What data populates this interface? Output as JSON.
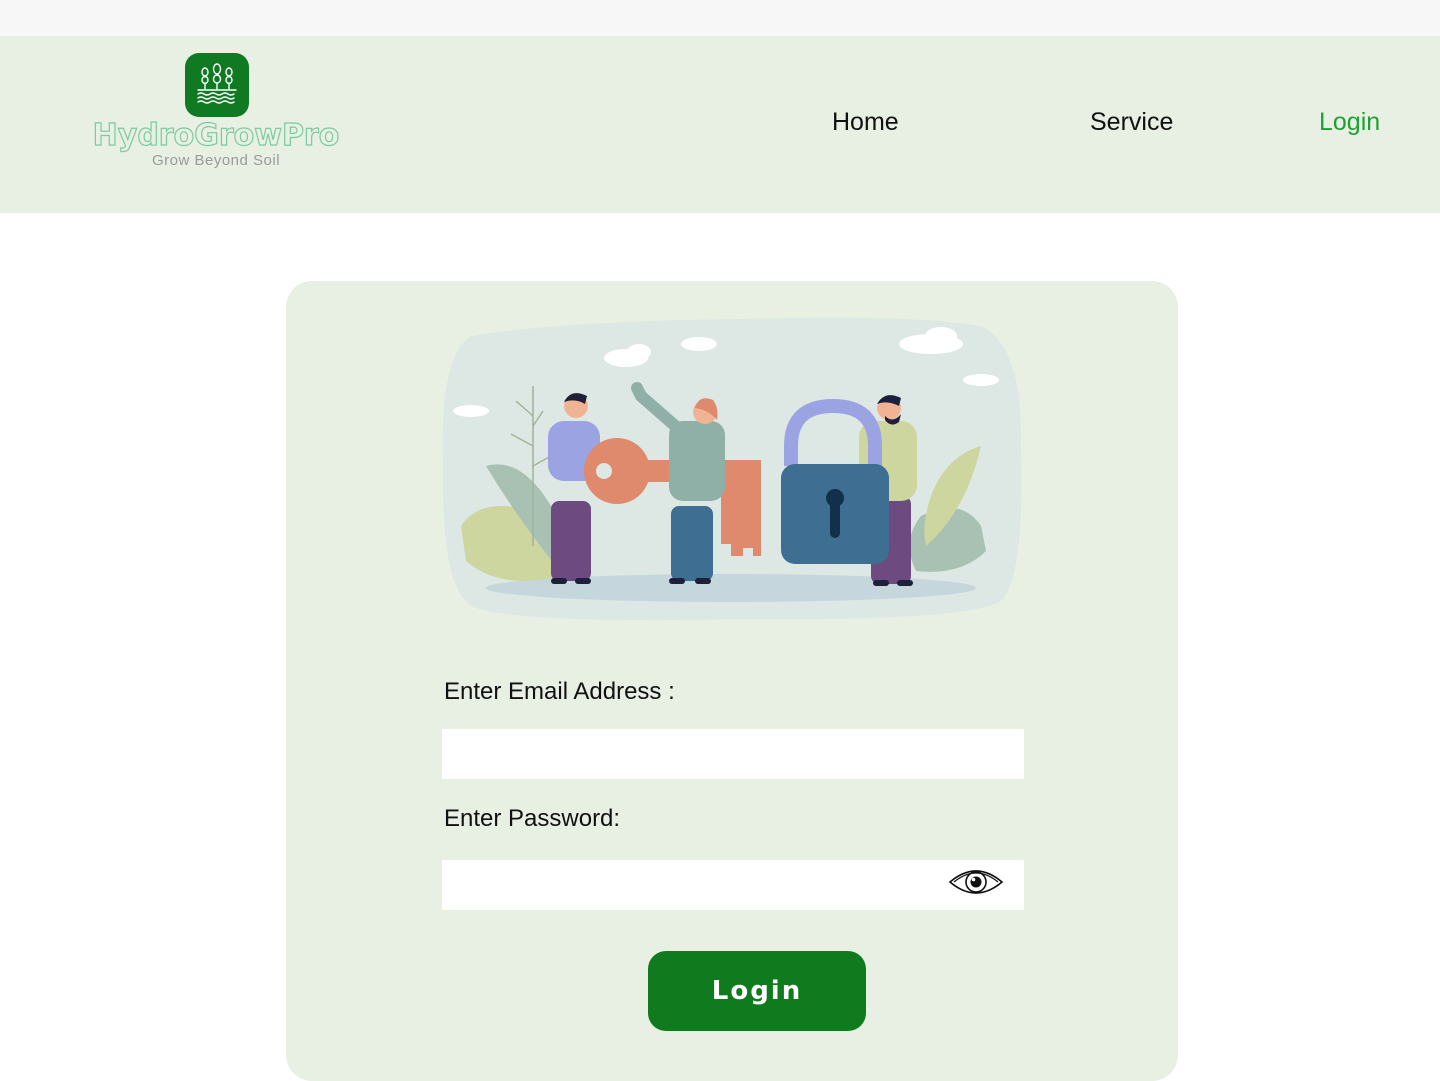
{
  "header": {
    "brand_name": "HydroGrowPro",
    "brand_tagline": "Grow Beyond Soil",
    "nav": {
      "home": "Home",
      "service": "Service",
      "login": "Login"
    }
  },
  "form": {
    "email_label": "Enter Email Address :",
    "email_value": "",
    "password_label": "Enter Password:",
    "password_value": "",
    "submit_label": "Login"
  },
  "colors": {
    "header_bg": "#e8f0e4",
    "card_bg": "#e8f0e4",
    "brand_green": "#0f7a1e",
    "active_nav": "#1fa034"
  },
  "icons": {
    "logo": "hydroponic-plant-icon",
    "password_toggle": "eye-icon"
  }
}
